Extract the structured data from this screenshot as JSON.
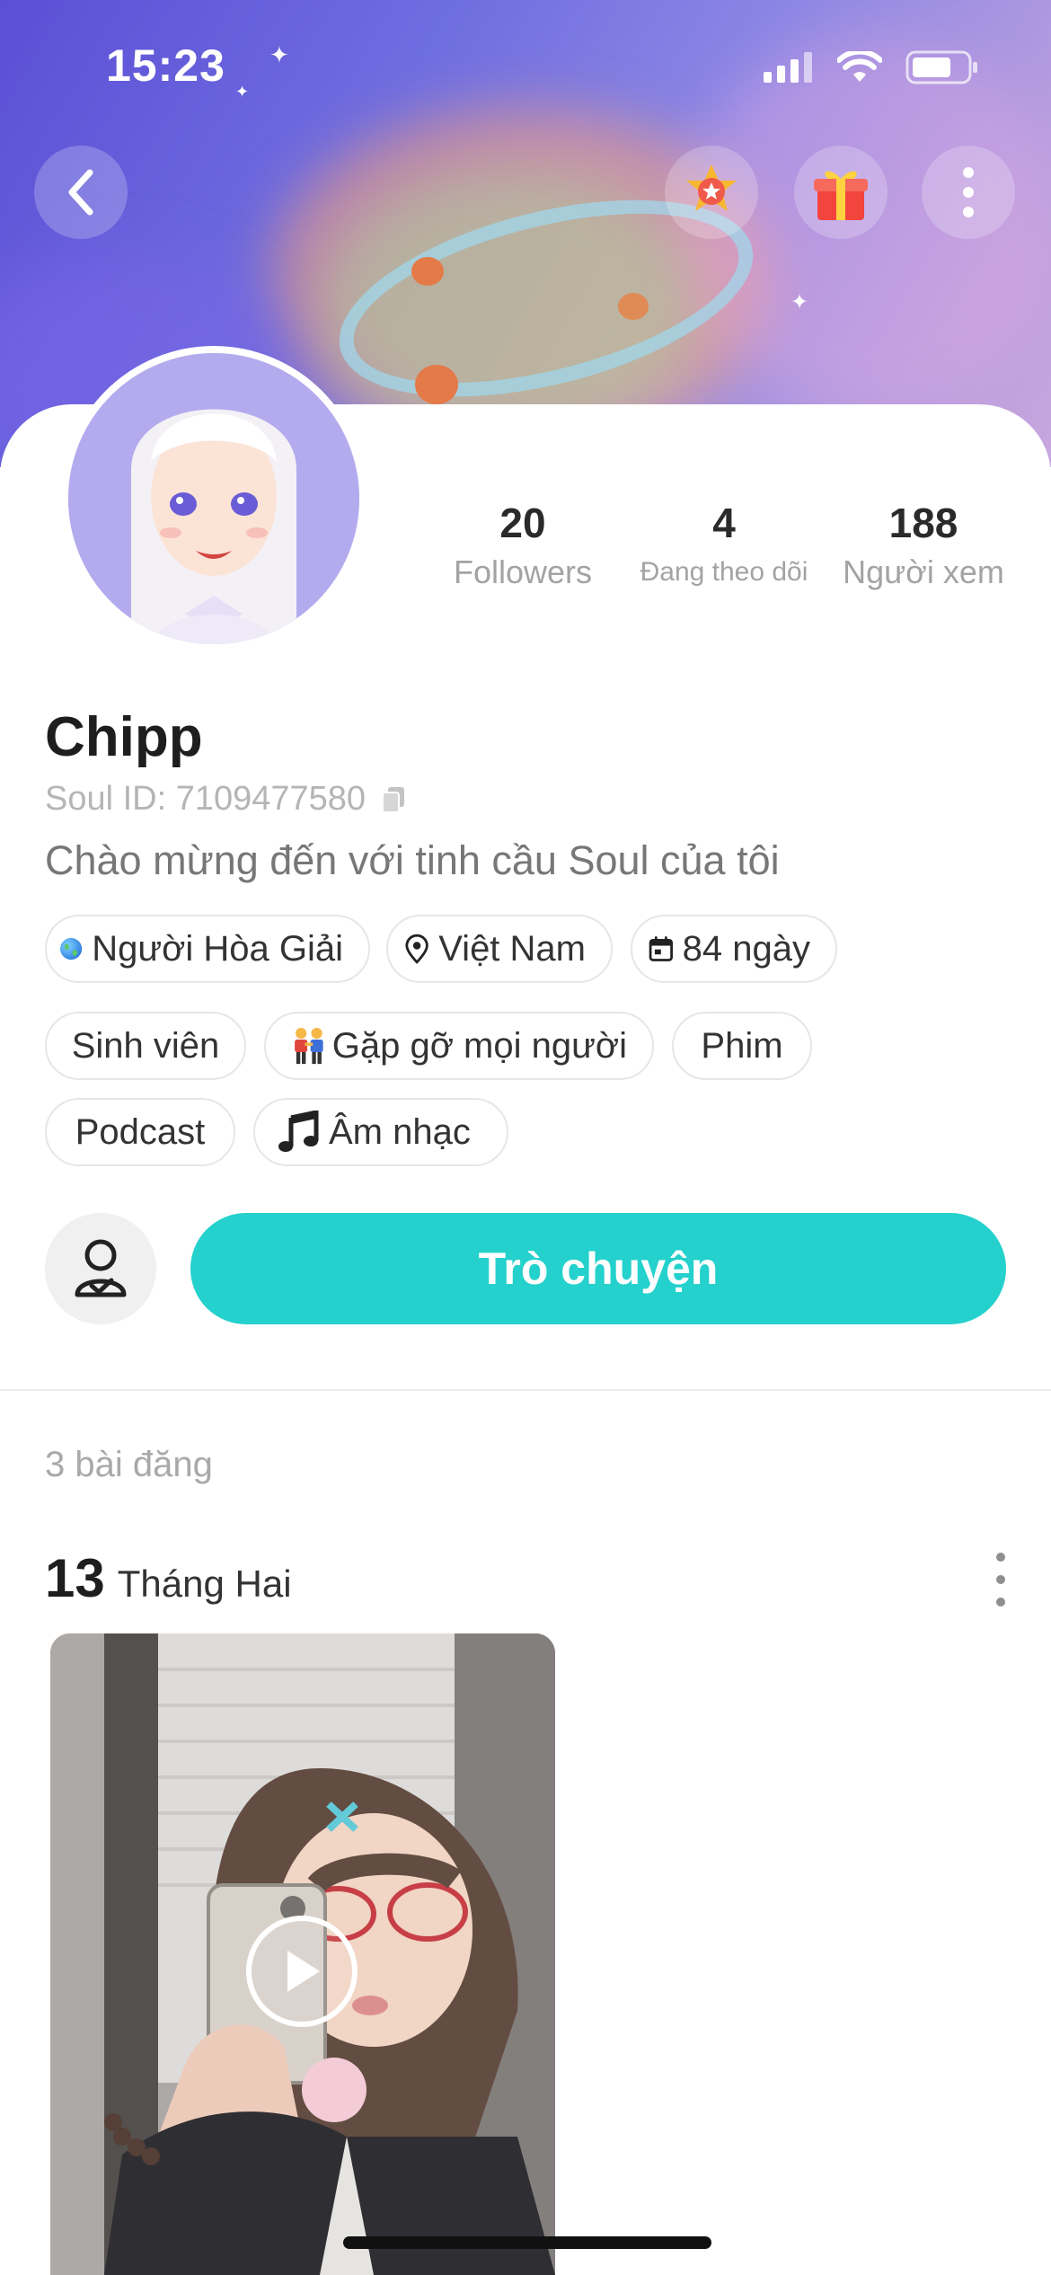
{
  "status_bar": {
    "time": "15:23"
  },
  "profile": {
    "name": "Chipp",
    "soul_id": "Soul ID: 7109477580",
    "bio": "Chào mừng đến với tinh cầu Soul của tôi"
  },
  "stats": [
    {
      "value": "20",
      "label": "Followers"
    },
    {
      "value": "4",
      "label": "Đang theo dõi"
    },
    {
      "value": "188",
      "label": "Người xem"
    }
  ],
  "info_tags": [
    {
      "label": "Người Hòa Giải",
      "icon": "globe-icon"
    },
    {
      "label": "Việt Nam",
      "icon": "location-pin-icon"
    },
    {
      "label": "84 ngày",
      "icon": "calendar-icon"
    }
  ],
  "interest_tags": [
    {
      "label": "Sinh viên"
    },
    {
      "label": "Gặp gỡ mọi người",
      "icon": "people-icon"
    },
    {
      "label": "Phim"
    },
    {
      "label": "Podcast"
    },
    {
      "label": "Âm nhạc",
      "icon": "music-note-icon"
    }
  ],
  "actions": {
    "chat_label": "Trò chuyện",
    "verify_icon": "verified-user-icon"
  },
  "posts": {
    "count_label": "3 bài đăng",
    "items": [
      {
        "day": "13",
        "month": "Tháng Hai",
        "media": "video",
        "icon": "play-icon"
      }
    ]
  },
  "header_icons": [
    "back-icon",
    "star-badge-icon",
    "gift-icon",
    "more-vertical-icon"
  ],
  "colors": {
    "accent": "#24d1cc",
    "banner_start": "#5b4fd6",
    "banner_end": "#c9a6de",
    "avatar_bg": "#b3abee"
  }
}
